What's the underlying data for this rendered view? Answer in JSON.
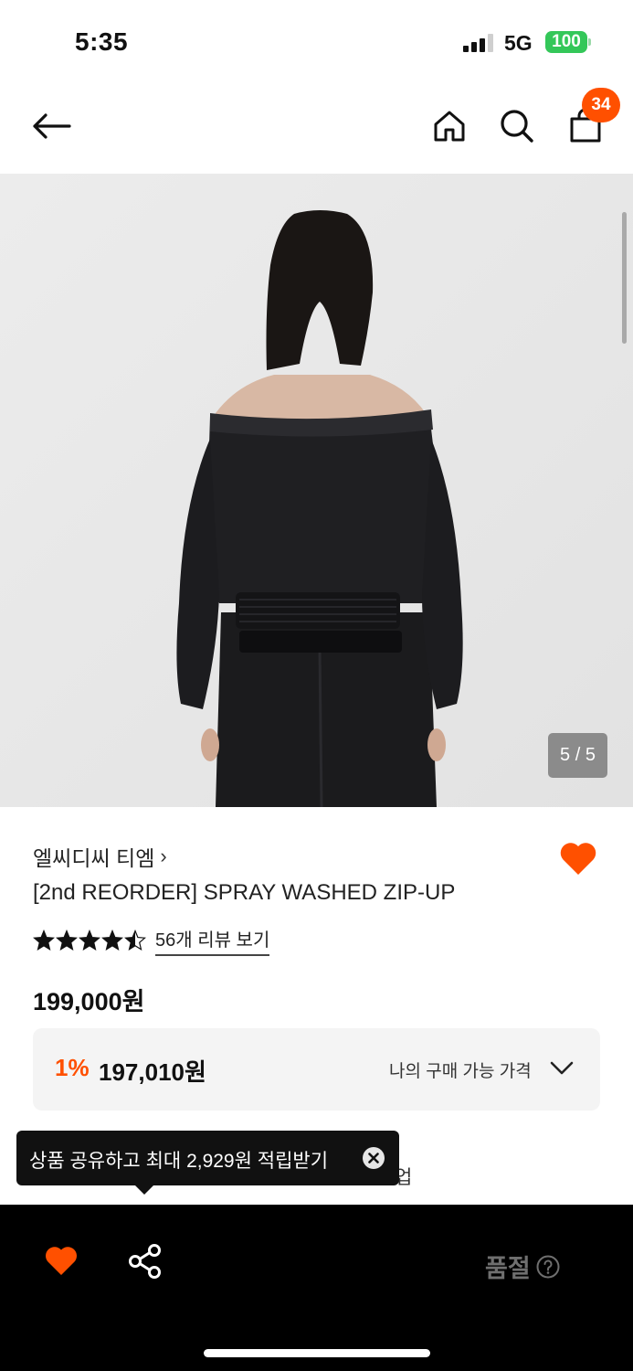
{
  "status_bar": {
    "time": "5:35",
    "network": "5G",
    "battery": "100",
    "icons": [
      "signal-icon",
      "battery-icon"
    ]
  },
  "nav": {
    "icons": [
      "back-arrow-icon",
      "home-icon",
      "search-icon",
      "shopping-bag-icon"
    ],
    "cart_count": "34"
  },
  "gallery": {
    "counter": "5 / 5",
    "current": 5,
    "total": 5
  },
  "product": {
    "brand": "엘씨디씨 티엠",
    "brand_chevron": "›",
    "title": "[2nd REORDER] SPRAY WASHED ZIP-UP",
    "rating": 4.5,
    "review_link": "56개 리뷰 보기",
    "price": "199,000원",
    "discount_rate": "1%",
    "discount_price": "197,010원",
    "my_price_label": "나의 구매 가능 가격",
    "partial_text": "업"
  },
  "tooltip": {
    "text": "상품 공유하고 최대 2,929원 적립받기"
  },
  "bottom_bar": {
    "soldout_label": "품절",
    "icons": [
      "heart-icon",
      "share-icon",
      "help-icon"
    ]
  },
  "colors": {
    "accent": "#ff5000",
    "black": "#000000",
    "price_box": "#f4f4f4"
  }
}
